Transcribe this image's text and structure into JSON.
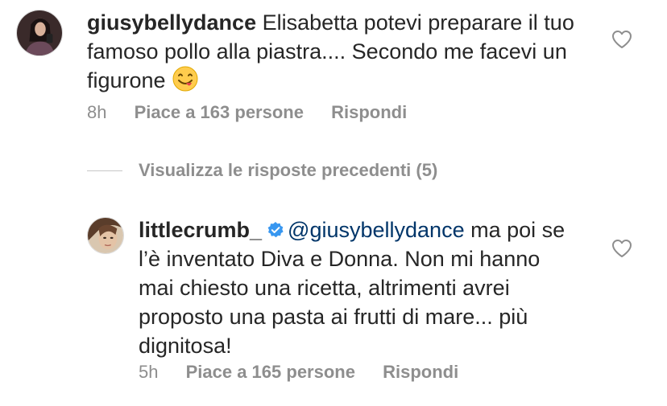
{
  "comments": [
    {
      "username": "giusybellydance",
      "text": "Elisabetta potevi preparare il tuo famoso pollo alla piastra.... Secondo me facevi un figurone",
      "emoji": "yummy-face-emoji",
      "time": "8h",
      "likes": "Piace a 163 persone",
      "reply": "Rispondi",
      "verified": false
    },
    {
      "username": "littlecrumb_",
      "mention": "@giusybellydance",
      "text": "ma poi se l’è inventato Diva e Donna. Non mi hanno mai chiesto una ricetta, altrimenti avrei proposto una pasta ai frutti di mare... più dignitosa!",
      "time": "5h",
      "likes": "Piace a 165 persone",
      "reply": "Rispondi",
      "verified": true
    }
  ],
  "view_replies": "Visualizza le risposte precedenti (5)",
  "icons": {
    "like": "heart-outline-icon",
    "verified": "verified-badge-icon"
  },
  "colors": {
    "text": "#262626",
    "muted": "#8e8e8e",
    "mention": "#003569",
    "verified": "#3897f0"
  }
}
